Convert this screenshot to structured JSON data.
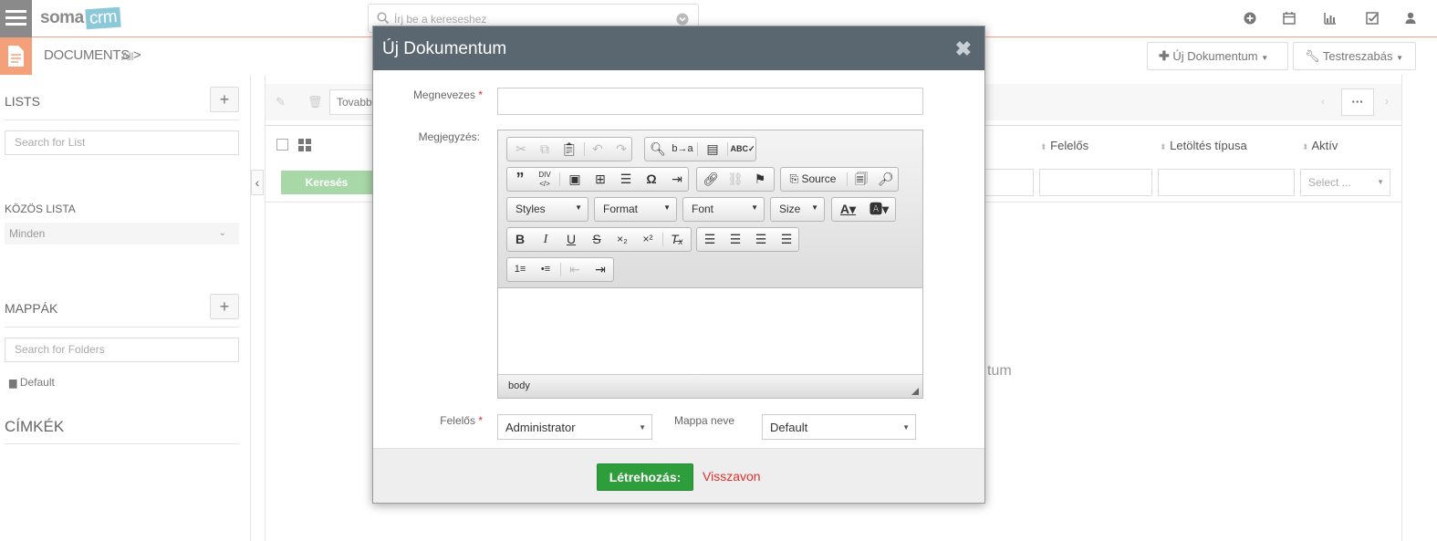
{
  "app": {
    "logo_main": "soma",
    "logo_accent": "crm"
  },
  "search": {
    "placeholder": "Írj be a kereseshez"
  },
  "breadcrumb": {
    "title": "DOCUMENTS",
    "separator": ">",
    "sub": "All"
  },
  "header_buttons": {
    "new_doc": "Új Dokumentum",
    "customize": "Testreszabás"
  },
  "sidebar": {
    "lists_title": "LISTS",
    "lists_search_placeholder": "Search for List",
    "shared_list_title": "KÖZÖS LISTA",
    "shared_list_value": "Minden",
    "folders_title": "MAPPÁK",
    "folders_search_placeholder": "Search for Folders",
    "folder_default": "Default",
    "tags_title": "CÍMKÉK"
  },
  "main": {
    "toolbar_more": "Tovabb",
    "search_button": "Keresés",
    "columns": [
      "Felelős",
      "Letöltés típusa",
      "Aktív"
    ],
    "active_filter_placeholder": "Select ...",
    "empty_partial": "tum",
    "pager_more": "···"
  },
  "modal": {
    "title": "Új Dokumentum",
    "close": "✖",
    "name_label": "Megnevezes",
    "name_required": "*",
    "note_label": "Megjegyzés:",
    "editor": {
      "source_label": "Source",
      "styles": "Styles",
      "format": "Format",
      "font": "Font",
      "size": "Size",
      "footer_path": "body"
    },
    "owner_label": "Felelős",
    "owner_required": "*",
    "owner_value": "Administrator",
    "folder_label": "Mappa neve",
    "folder_value": "Default",
    "create_button": "Létrehozás:",
    "cancel_link": "Visszavon"
  },
  "colors": {
    "accent": "#f4a07a",
    "header": "#5a6670",
    "create": "#2e9e3c",
    "cancel": "#e03030",
    "search_btn": "#a8d8a8"
  }
}
